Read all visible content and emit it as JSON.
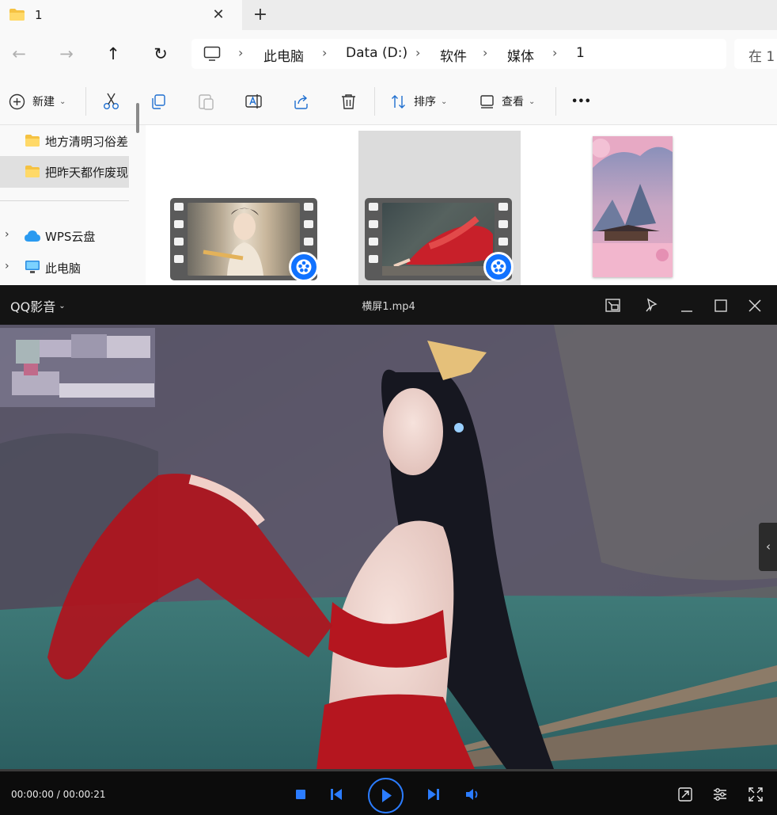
{
  "explorer": {
    "tab": {
      "title": "1",
      "close_glyph": "✕",
      "add_glyph": "+"
    },
    "nav": {
      "back": "←",
      "forward": "→",
      "up": "↑",
      "refresh": "↻"
    },
    "address": {
      "crumbs": [
        "此电脑",
        "Data (D:)",
        "软件",
        "媒体",
        "1"
      ],
      "separator": "›"
    },
    "search": {
      "placeholder": "在 1"
    },
    "toolbar": {
      "new_label": "新建",
      "sort_label": "排序",
      "view_label": "查看",
      "more_label": "•••",
      "caret": "⌄"
    },
    "sidebar": {
      "items": [
        {
          "label": "地方清明习俗差"
        },
        {
          "label": "把昨天都作废现"
        },
        {
          "label": "WPS云盘"
        },
        {
          "label": "此电脑"
        }
      ],
      "chevron": "›"
    },
    "files": [
      {
        "type": "video",
        "icon": "qq-player-icon"
      },
      {
        "type": "video",
        "icon": "qq-player-icon",
        "selected": true
      },
      {
        "type": "image"
      }
    ]
  },
  "player": {
    "app_name": "QQ影音",
    "caret": "⌄",
    "file_name": "横屏1.mp4",
    "side_handle": "‹",
    "time": "00:00:00 / 00:00:21",
    "progress": 0
  },
  "colors": {
    "accent": "#2b7cff",
    "folder": "#f5c242",
    "player_bg": "#141414"
  }
}
